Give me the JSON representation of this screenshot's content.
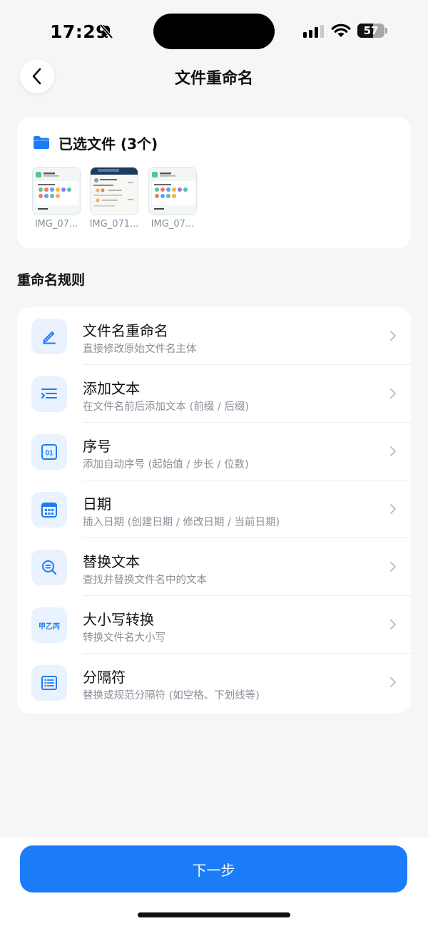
{
  "status_bar": {
    "time": "17:29",
    "battery_level": "57",
    "battery_fraction": 0.57,
    "icons": [
      "bell-slash-icon",
      "signal-icon",
      "wifi-icon",
      "battery-icon"
    ]
  },
  "header": {
    "title": "文件重命名",
    "back_icon": "chevron-left-icon"
  },
  "selected_files": {
    "title": "已选文件 (3个)",
    "icon": "folder-icon",
    "files": [
      {
        "name": "IMG_07..."
      },
      {
        "name": "IMG_071..."
      },
      {
        "name": "IMG_07..."
      }
    ]
  },
  "rules_section": {
    "title": "重命名规则",
    "items": [
      {
        "title": "文件名重命名",
        "description": "直接修改原始文件名主体",
        "icon": "pencil-icon"
      },
      {
        "title": "添加文本",
        "description": "在文件名前后添加文本 (前缀 / 后缀)",
        "icon": "text-insert-icon"
      },
      {
        "title": "序号",
        "description": "添加自动序号 (起始值 / 步长 / 位数)",
        "icon": "number-icon",
        "icon_text": "01"
      },
      {
        "title": "日期",
        "description": "插入日期 (创建日期 / 修改日期 / 当前日期)",
        "icon": "calendar-icon"
      },
      {
        "title": "替换文本",
        "description": "查找并替换文件名中的文本",
        "icon": "search-replace-icon"
      },
      {
        "title": "大小写转换",
        "description": "转换文件名大小写",
        "icon": "case-convert-icon",
        "icon_text": "甲乙丙"
      },
      {
        "title": "分隔符",
        "description": "替换或规范分隔符 (如空格、下划线等)",
        "icon": "separator-icon"
      }
    ]
  },
  "footer": {
    "next_label": "下一步"
  },
  "colors": {
    "accent": "#1a7cf7",
    "icon_bg": "#e9f2fe",
    "page_bg": "#f5f6f8",
    "secondary_text": "#8a8f98"
  }
}
